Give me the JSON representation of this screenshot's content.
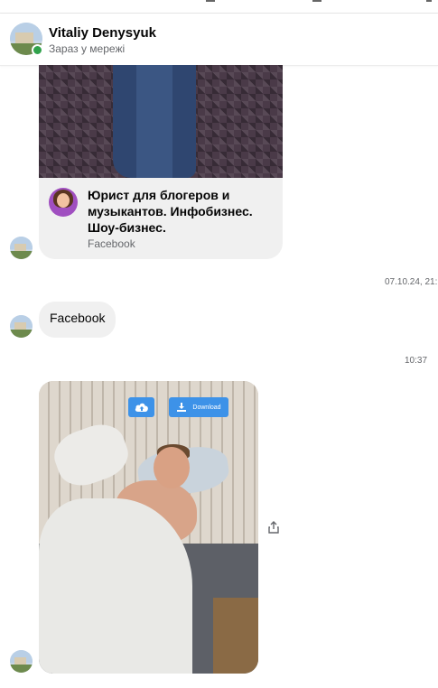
{
  "header": {
    "name": "Vitaliy Denysyuk",
    "status": "Зараз у мережі"
  },
  "messages": {
    "link_card": {
      "title": "Юрист для блогеров и музыкантов. Инфобизнес. Шоу-бизнес.",
      "source": "Facebook"
    },
    "timestamp_1": "07.10.24, 21:",
    "text_bubble": "Facebook",
    "timestamp_2": "10:37",
    "photo_overlay": {
      "download_label": "Download"
    }
  },
  "colors": {
    "online": "#31a24c",
    "bubble": "#f0f0f0",
    "overlay_button": "#3d92e8"
  }
}
